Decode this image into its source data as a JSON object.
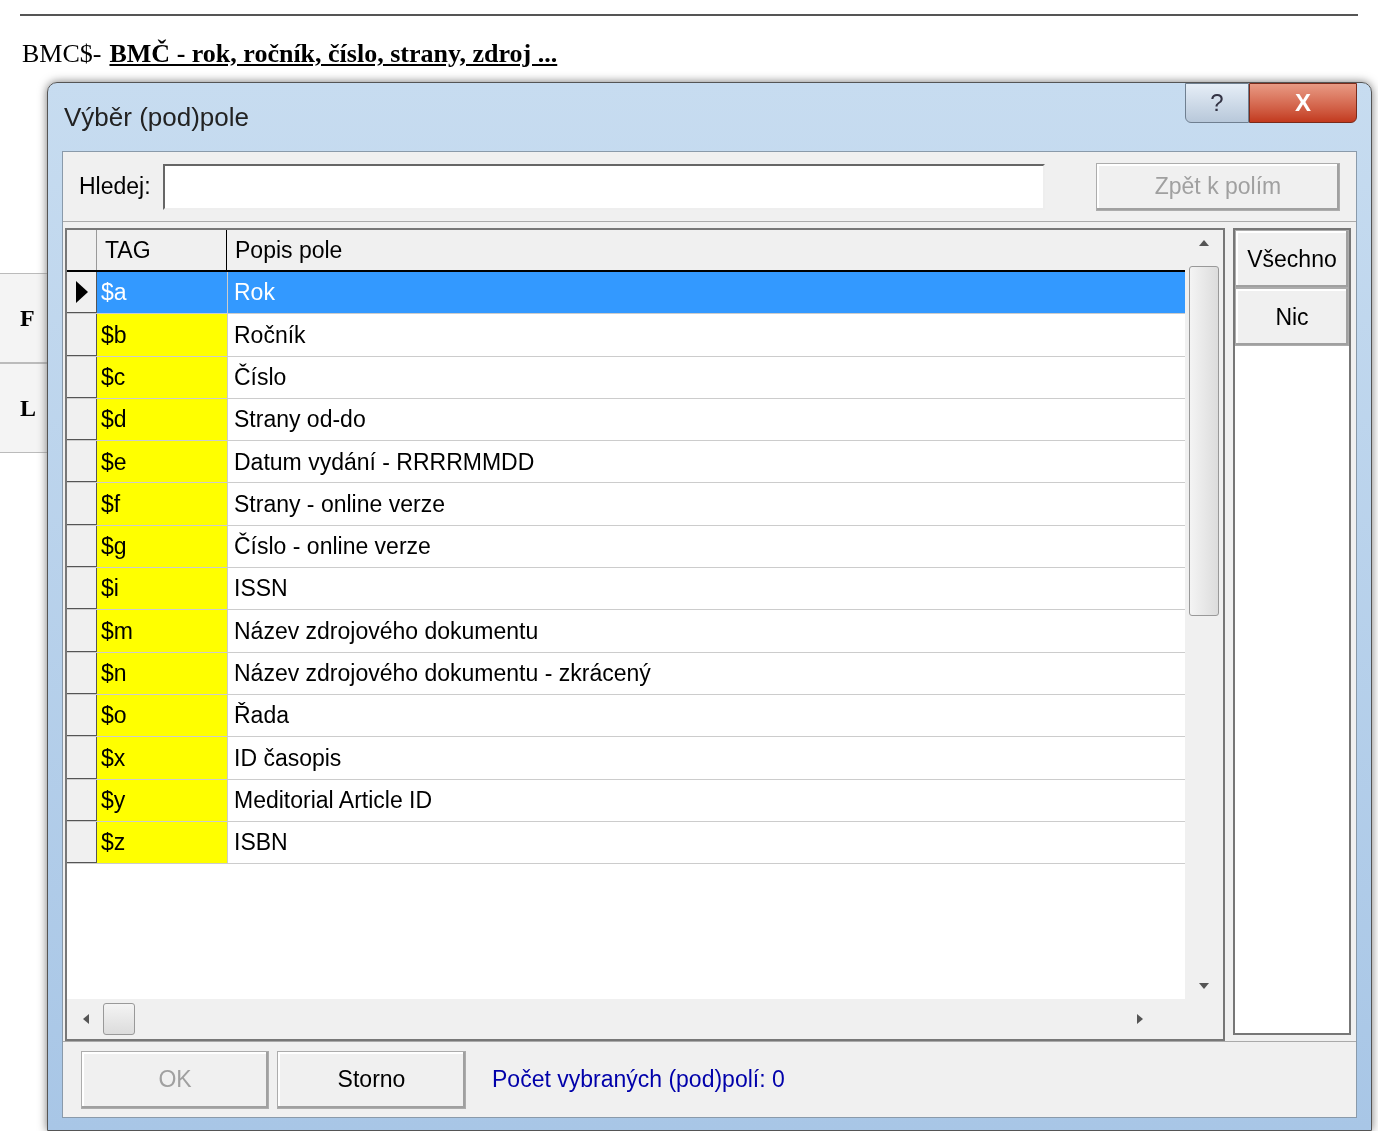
{
  "page": {
    "heading_prefix": "BMC$-",
    "heading_link": "BMČ - rok, ročník, číslo, strany, zdroj ...",
    "side_labels": [
      "F",
      "L"
    ]
  },
  "dialog": {
    "title": "Výběr (pod)pole",
    "help_button": "?",
    "close_button": "X",
    "search": {
      "label": "Hledej:"
    },
    "back_button": {
      "label": "Zpět k polím",
      "disabled": true
    },
    "table": {
      "columns": [
        "TAG",
        "Popis pole"
      ],
      "rows": [
        {
          "tag": "$a",
          "description": "Rok",
          "selected": true
        },
        {
          "tag": "$b",
          "description": "Ročník",
          "selected": false
        },
        {
          "tag": "$c",
          "description": "Číslo",
          "selected": false
        },
        {
          "tag": "$d",
          "description": "Strany od-do",
          "selected": false
        },
        {
          "tag": "$e",
          "description": "Datum vydání - RRRRMMDD",
          "selected": false
        },
        {
          "tag": "$f",
          "description": "Strany - online verze",
          "selected": false
        },
        {
          "tag": "$g",
          "description": "Číslo - online verze",
          "selected": false
        },
        {
          "tag": "$i",
          "description": "ISSN",
          "selected": false
        },
        {
          "tag": "$m",
          "description": "Název zdrojového dokumentu",
          "selected": false
        },
        {
          "tag": "$n",
          "description": "Název zdrojového dokumentu - zkrácený",
          "selected": false
        },
        {
          "tag": "$o",
          "description": "Řada",
          "selected": false
        },
        {
          "tag": "$x",
          "description": "ID časopis",
          "selected": false
        },
        {
          "tag": "$y",
          "description": "Meditorial Article ID",
          "selected": false
        },
        {
          "tag": "$z",
          "description": "ISBN",
          "selected": false
        }
      ]
    },
    "side_buttons": [
      "Všechno",
      "Nic"
    ],
    "ok_button": {
      "label": "OK",
      "disabled": true
    },
    "cancel_button": {
      "label": "Storno",
      "disabled": false
    },
    "status": "Počet vybraných (pod)polí: 0"
  }
}
